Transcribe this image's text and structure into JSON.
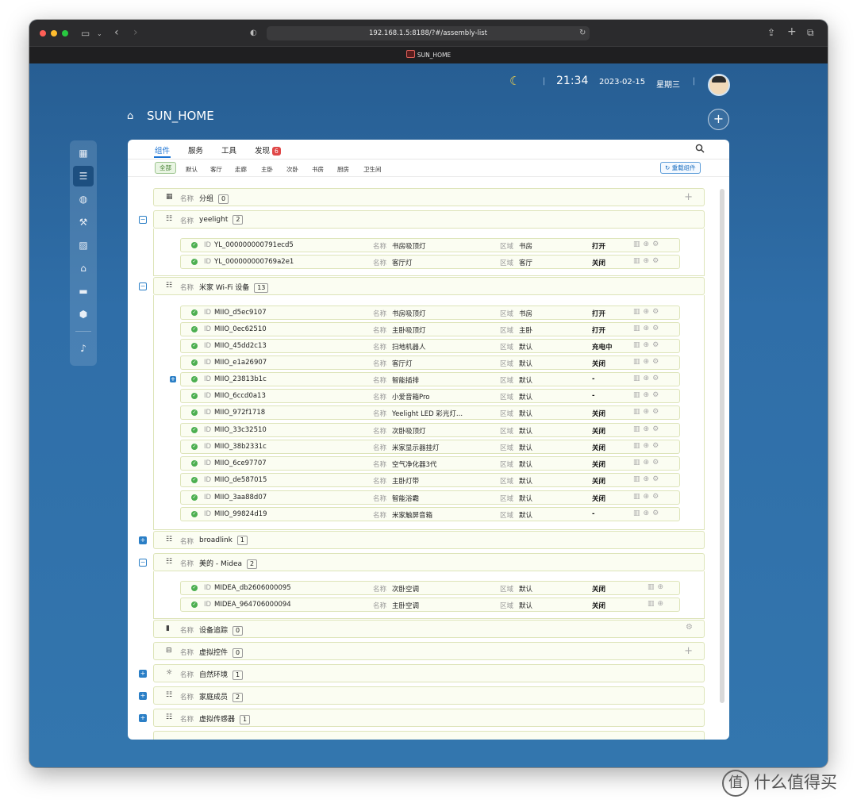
{
  "browser": {
    "url": "192.168.1.5:8188/?#/assembly-list",
    "tab_title": "SUN_HOME"
  },
  "header": {
    "time": "21:34",
    "date": "2023-02-15",
    "weekday": "星期三",
    "home_title": "SUN_HOME"
  },
  "tabs": [
    {
      "label": "组件"
    },
    {
      "label": "服务"
    },
    {
      "label": "工具"
    },
    {
      "label": "发现",
      "badge": "6"
    }
  ],
  "filters": [
    "全部",
    "默认",
    "客厅",
    "走廊",
    "主卧",
    "次卧",
    "书房",
    "厨房",
    "卫生间"
  ],
  "reload_label": "重载组件",
  "labels": {
    "name": "名称",
    "id": "ID",
    "area": "区域"
  },
  "groups": [
    {
      "name": "分组",
      "count": "0"
    },
    {
      "name": "yeelight",
      "count": "2"
    },
    {
      "name": "米家 Wi-Fi 设备",
      "count": "13"
    },
    {
      "name": "broadlink",
      "count": "1"
    },
    {
      "name": "美的 - Midea",
      "count": "2"
    },
    {
      "name": "设备追踪",
      "count": "0"
    },
    {
      "name": "虚拟控件",
      "count": "0"
    },
    {
      "name": "自然环境",
      "count": "1"
    },
    {
      "name": "家庭成员",
      "count": "2"
    },
    {
      "name": "虚拟传感器",
      "count": "1"
    }
  ],
  "devices": [
    {
      "id": "YL_000000000791ecd5",
      "name": "书房吸顶灯",
      "area": "书房",
      "status": "打开"
    },
    {
      "id": "YL_000000000769a2e1",
      "name": "客厅灯",
      "area": "客厅",
      "status": "关闭"
    },
    {
      "id": "MIIO_d5ec9107",
      "name": "书房吸顶灯",
      "area": "书房",
      "status": "打开"
    },
    {
      "id": "MIIO_0ec62510",
      "name": "主卧吸顶灯",
      "area": "主卧",
      "status": "打开"
    },
    {
      "id": "MIIO_45dd2c13",
      "name": "扫地机器人",
      "area": "默认",
      "status": "充电中"
    },
    {
      "id": "MIIO_e1a26907",
      "name": "客厅灯",
      "area": "默认",
      "status": "关闭"
    },
    {
      "id": "MIIO_23813b1c",
      "name": "智能插排",
      "area": "默认",
      "status": "-"
    },
    {
      "id": "MIIO_6ccd0a13",
      "name": "小爱音箱Pro",
      "area": "默认",
      "status": "-"
    },
    {
      "id": "MIIO_972f1718",
      "name": "Yeelight LED 彩光灯...",
      "area": "默认",
      "status": "关闭"
    },
    {
      "id": "MIIO_33c32510",
      "name": "次卧吸顶灯",
      "area": "默认",
      "status": "关闭"
    },
    {
      "id": "MIIO_38b2331c",
      "name": "米家显示器挂灯",
      "area": "默认",
      "status": "关闭"
    },
    {
      "id": "MIIO_6ce97707",
      "name": "空气净化器3代",
      "area": "默认",
      "status": "关闭"
    },
    {
      "id": "MIIO_de587015",
      "name": "主卧灯带",
      "area": "默认",
      "status": "关闭"
    },
    {
      "id": "MIIO_3aa88d07",
      "name": "智能浴霸",
      "area": "默认",
      "status": "关闭"
    },
    {
      "id": "MIIO_99824d19",
      "name": "米家触屏音箱",
      "area": "默认",
      "status": "-"
    },
    {
      "id": "MIDEA_db2606000095",
      "name": "次卧空调",
      "area": "默认",
      "status": "关闭"
    },
    {
      "id": "MIDEA_964706000094",
      "name": "主卧空调",
      "area": "默认",
      "status": "关闭"
    }
  ],
  "watermark": "什么值得买"
}
